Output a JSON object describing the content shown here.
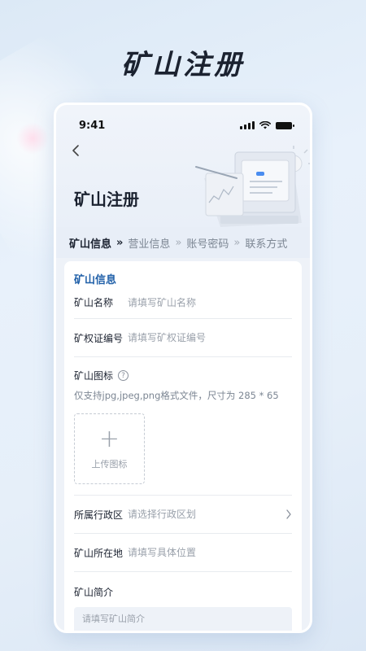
{
  "promo": {
    "title": "矿山注册"
  },
  "status_bar": {
    "time": "9:41"
  },
  "header": {
    "title": "矿山注册"
  },
  "steps": [
    {
      "label": "矿山信息",
      "active": true
    },
    {
      "label": "营业信息",
      "active": false
    },
    {
      "label": "账号密码",
      "active": false
    },
    {
      "label": "联系方式",
      "active": false
    }
  ],
  "step_separator": "»",
  "form": {
    "section_title": "矿山信息",
    "mine_name": {
      "label": "矿山名称",
      "placeholder": "请填写矿山名称"
    },
    "license_no": {
      "label": "矿权证编号",
      "placeholder": "请填写矿权证编号"
    },
    "mine_icon": {
      "label": "矿山图标",
      "help": "?",
      "hint": "仅支持jpg,jpeg,png格式文件，尺寸为 285 * 65",
      "upload_plus": "+",
      "upload_label": "上传图标"
    },
    "region": {
      "label": "所属行政区",
      "placeholder": "请选择行政区划"
    },
    "location": {
      "label": "矿山所在地",
      "placeholder": "请填写具体位置"
    },
    "intro": {
      "label": "矿山简介",
      "placeholder": "请填写矿山简介"
    }
  },
  "colors": {
    "accent": "#1f5fa8",
    "text_primary": "#1b2230",
    "text_secondary": "#7c8693"
  }
}
